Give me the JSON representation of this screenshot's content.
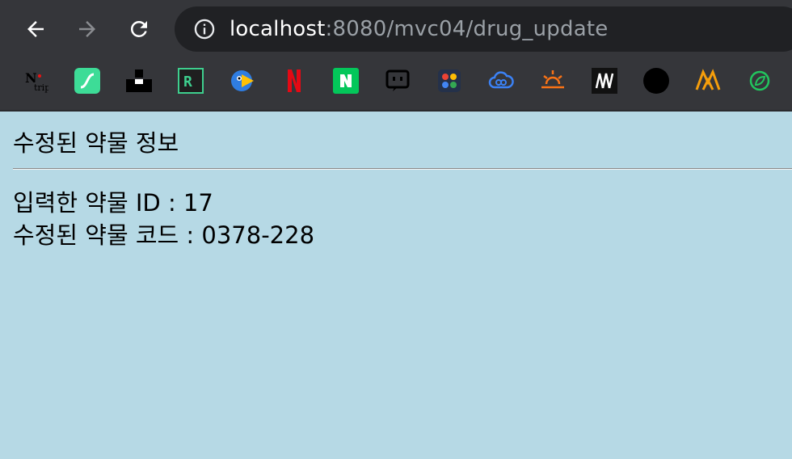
{
  "browser": {
    "url_host": "localhost",
    "url_path": ":8080/mvc04/drug_update",
    "nav": {
      "back_icon": "arrow-left-icon",
      "forward_icon": "arrow-right-icon",
      "reload_icon": "reload-icon",
      "info_icon": "info-icon"
    },
    "bookmarks": [
      {
        "name": "naver-trip-icon",
        "color": "#000000"
      },
      {
        "name": "green-wave-icon",
        "color": "#3ddc97"
      },
      {
        "name": "black-blocks-icon",
        "color": "#000000"
      },
      {
        "name": "r-box-icon",
        "color": "#3ecf8e"
      },
      {
        "name": "bird-icon",
        "color": "#2f7de1"
      },
      {
        "name": "netflix-icon",
        "color": "#e50914"
      },
      {
        "name": "naver-n-icon",
        "color": "#03c75a"
      },
      {
        "name": "chat-bubble-icon",
        "color": "#000000"
      },
      {
        "name": "color-tiles-icon",
        "color": "#4285f4"
      },
      {
        "name": "cloud-link-icon",
        "color": "#3b82f6"
      },
      {
        "name": "sunrise-icon",
        "color": "#f97316"
      },
      {
        "name": "m-logo-icon",
        "color": "#000000"
      },
      {
        "name": "black-circle-icon",
        "color": "#000000"
      },
      {
        "name": "m-mountain-icon",
        "color": "#f59e0b"
      },
      {
        "name": "leaf-icon",
        "color": "#22c55e"
      }
    ]
  },
  "page": {
    "title": "수정된 약물 정보",
    "input_id_line": "입력한 약물 ID : 17",
    "updated_code_line": "수정된 약물 코드 : 0378-228",
    "background": "#b6d9e5"
  }
}
